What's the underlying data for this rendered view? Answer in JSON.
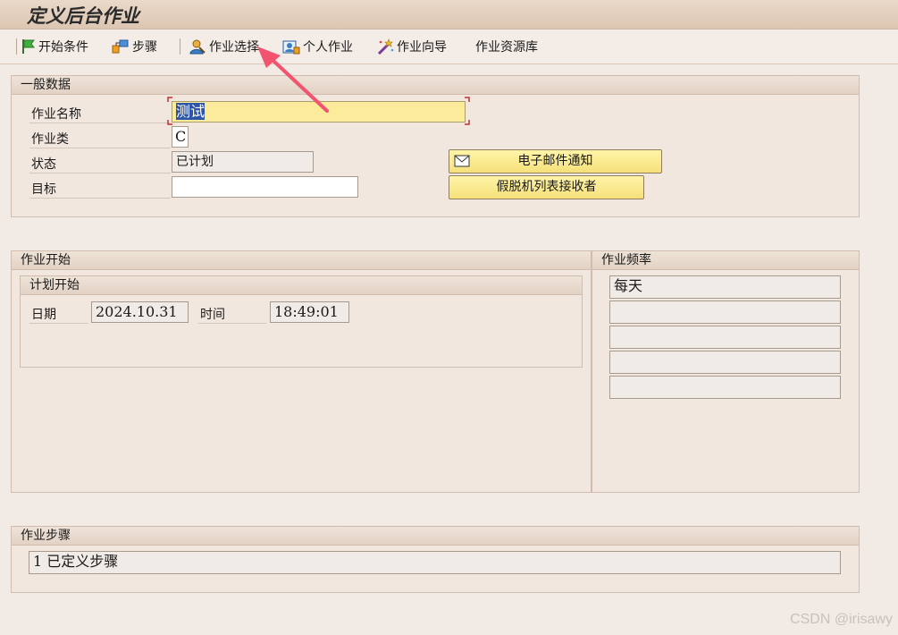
{
  "window": {
    "title": "定义后台作业"
  },
  "toolbar": {
    "items": [
      {
        "label": "开始条件",
        "icon": "green-flag-icon"
      },
      {
        "label": "步骤",
        "icon": "steps-icon"
      },
      {
        "label": "作业选择",
        "icon": "job-selection-icon"
      },
      {
        "label": "个人作业",
        "icon": "own-jobs-icon"
      },
      {
        "label": "作业向导",
        "icon": "wizard-wand-icon"
      },
      {
        "label": "作业资源库",
        "icon": ""
      }
    ]
  },
  "general": {
    "title": "一般数据",
    "job_name_label": "作业名称",
    "job_name_value": "测试",
    "job_class_label": "作业类",
    "job_class_value": "C",
    "status_label": "状态",
    "status_value": "已计划",
    "target_label": "目标",
    "target_value": "",
    "email_button": "电子邮件通知",
    "spool_button": "假脱机列表接收者"
  },
  "job_start": {
    "title": "作业开始",
    "planned_title": "计划开始",
    "date_label": "日期",
    "date_value": "2024.10.31",
    "time_label": "时间",
    "time_value": "18:49:01"
  },
  "frequency": {
    "title": "作业频率",
    "values": [
      "每天",
      "",
      "",
      "",
      ""
    ]
  },
  "steps": {
    "title": "作业步骤",
    "value": "1 已定义步骤"
  },
  "watermark": "CSDN @irisawy",
  "colors": {
    "highlight_field": "#fbeb9b",
    "arrow": "#f25470"
  }
}
